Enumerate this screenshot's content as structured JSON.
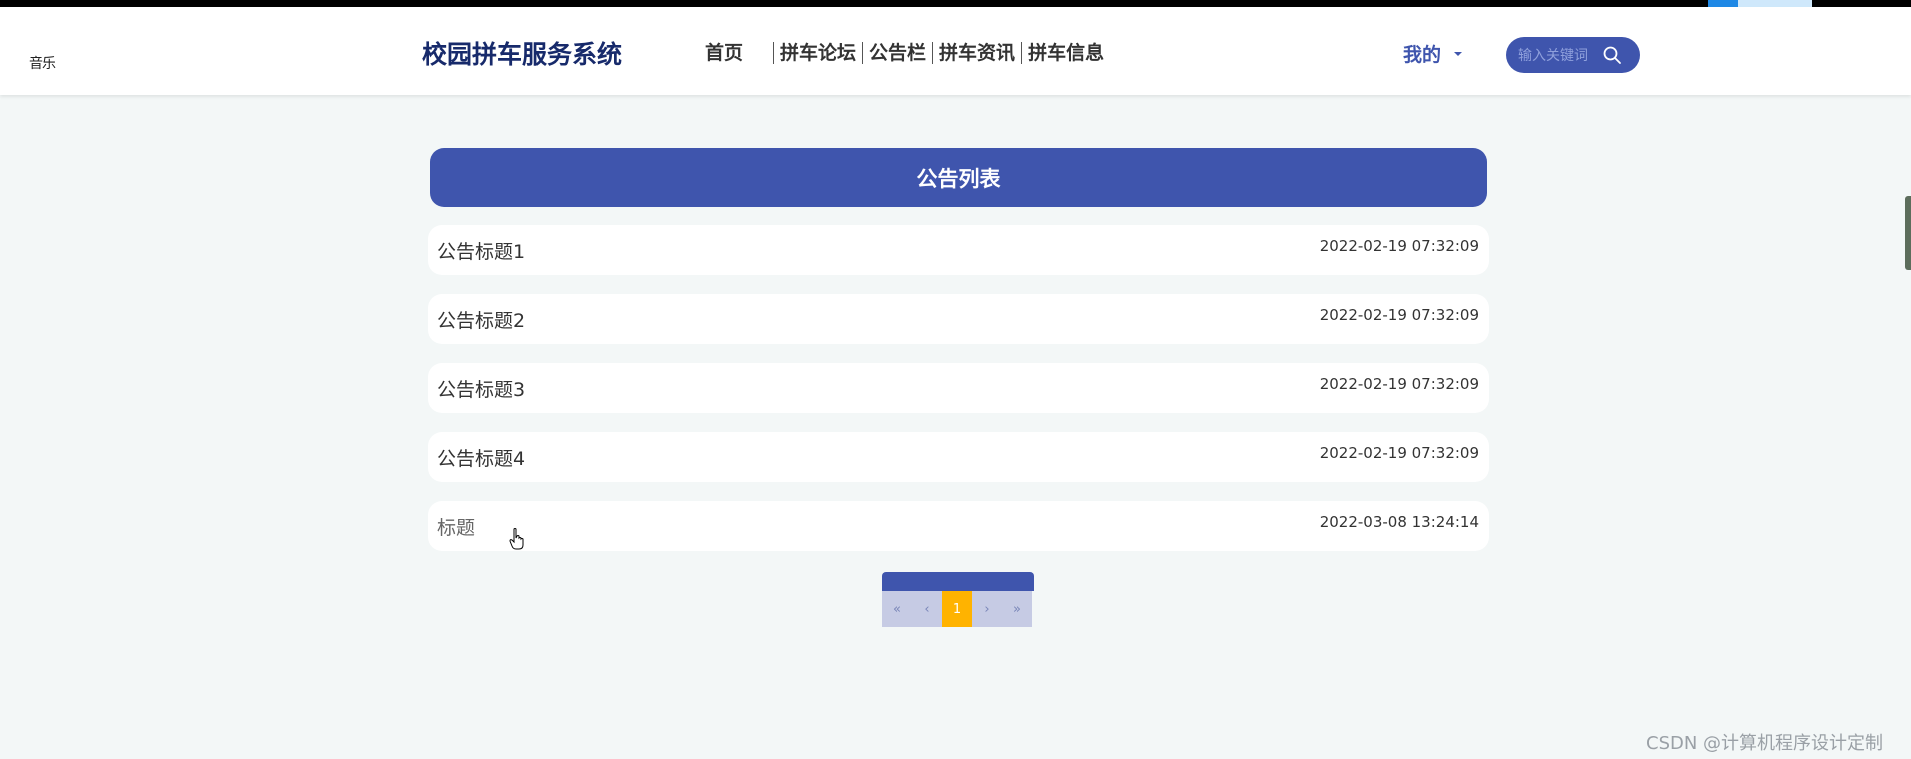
{
  "header": {
    "music": "音乐",
    "logo": "校园拼车服务系统",
    "nav": [
      "首页",
      "拼车论坛",
      "公告栏",
      "拼车资讯",
      "拼车信息"
    ],
    "mine": "我的",
    "search_placeholder": "输入关键词"
  },
  "panel": {
    "title": "公告列表"
  },
  "announcements": [
    {
      "title": "公告标题1",
      "date": "2022-02-19 07:32:09"
    },
    {
      "title": "公告标题2",
      "date": "2022-02-19 07:32:09"
    },
    {
      "title": "公告标题3",
      "date": "2022-02-19 07:32:09"
    },
    {
      "title": "公告标题4",
      "date": "2022-02-19 07:32:09"
    },
    {
      "title": "标题",
      "date": "2022-03-08 13:24:14"
    }
  ],
  "pagination": {
    "first": "«",
    "prev": "‹",
    "current": "1",
    "next": "›",
    "last": "»"
  },
  "watermark": "CSDN @计算机程序设计定制",
  "colors": {
    "primary": "#3f55ad",
    "accent": "#ffb300",
    "background": "#f3f7f7"
  }
}
